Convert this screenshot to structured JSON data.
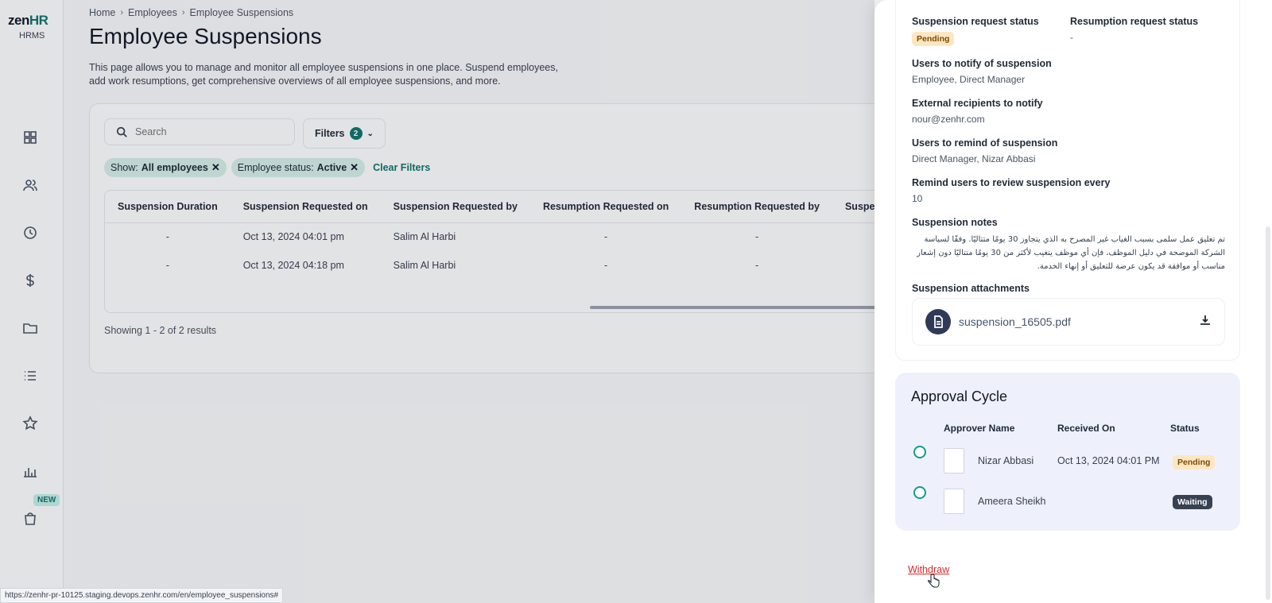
{
  "app": {
    "logo_brand": "zen",
    "logo_hr": "HR",
    "logo_sub": "HRMS",
    "new_badge": "NEW"
  },
  "sidebar": {
    "icons": [
      "dashboard-icon",
      "people-icon",
      "clock-icon",
      "dollar-icon",
      "folder-icon",
      "list-icon",
      "star-icon",
      "bar-chart-icon",
      "bag-icon"
    ]
  },
  "breadcrumb": {
    "home": "Home",
    "employees": "Employees",
    "current": "Employee Suspensions"
  },
  "page": {
    "title": "Employee Suspensions",
    "description": "This page allows you to manage and monitor all employee suspensions in one place. Suspend employees, add work resumptions, get comprehensive overviews of all employee suspensions, and more."
  },
  "search": {
    "placeholder": "Search"
  },
  "filters": {
    "label": "Filters",
    "count": "2"
  },
  "chips": [
    {
      "key": "Show:",
      "value": "All employees"
    },
    {
      "key": "Employee status:",
      "value": "Active"
    }
  ],
  "clear_filters": "Clear Filters",
  "table": {
    "headers": [
      "Suspension Duration",
      "Suspension Requested on",
      "Suspension Requested by",
      "Resumption Requested on",
      "Resumption Requested by",
      "Suspen"
    ],
    "rows": [
      [
        "-",
        "Oct 13, 2024 04:01 pm",
        "Salim Al Harbi",
        "-",
        "-"
      ],
      [
        "-",
        "Oct 13, 2024 04:18 pm",
        "Salim Al Harbi",
        "-",
        "-"
      ]
    ]
  },
  "results_text": "Showing 1 - 2 of 2 results",
  "status_url": "https://zenhr-pr-10125.staging.devops.zenhr.com/en/employee_suspensions#",
  "drawer": {
    "suspension_status_label": "Suspension request status",
    "suspension_status": "Pending",
    "resumption_status_label": "Resumption request status",
    "resumption_status": "-",
    "notify_label": "Users to notify of suspension",
    "notify_value": "Employee, Direct Manager",
    "external_label": "External recipients to notify",
    "external_value": "nour@zenhr.com",
    "remind_label": "Users to remind of suspension",
    "remind_value": "Direct Manager, Nizar Abbasi",
    "remind_every_label": "Remind users to review suspension every",
    "remind_every_value": "10",
    "notes_label": "Suspension notes",
    "notes_value": "تم تعليق عمل سلمى بسبب الغياب غير المصرح به الذي يتجاوز 30 يومًا متتاليًا. وفقًا لسياسة الشركة الموضحة في دليل الموظف، فإن أي موظف يتغيب لأكثر من 30 يومًا متتاليًا دون إشعار مناسب أو موافقة قد يكون عرضة للتعليق أو إنهاء الخدمة.",
    "attachments_label": "Suspension attachments",
    "attachment_name": "suspension_16505.pdf"
  },
  "approval": {
    "title": "Approval Cycle",
    "headers": {
      "name": "Approver Name",
      "received": "Received On",
      "status": "Status"
    },
    "rows": [
      {
        "name": "Nizar Abbasi",
        "received": "Oct 13, 2024 04:01 PM",
        "status": "Pending"
      },
      {
        "name": "Ameera Sheikh",
        "received": "",
        "status": "Waiting"
      }
    ]
  },
  "withdraw_label": "Withdraw",
  "colors": {
    "accent": "#0f766e",
    "pending_bg": "#fde7c3",
    "waiting_bg": "#374151",
    "danger": "#dc2626"
  }
}
